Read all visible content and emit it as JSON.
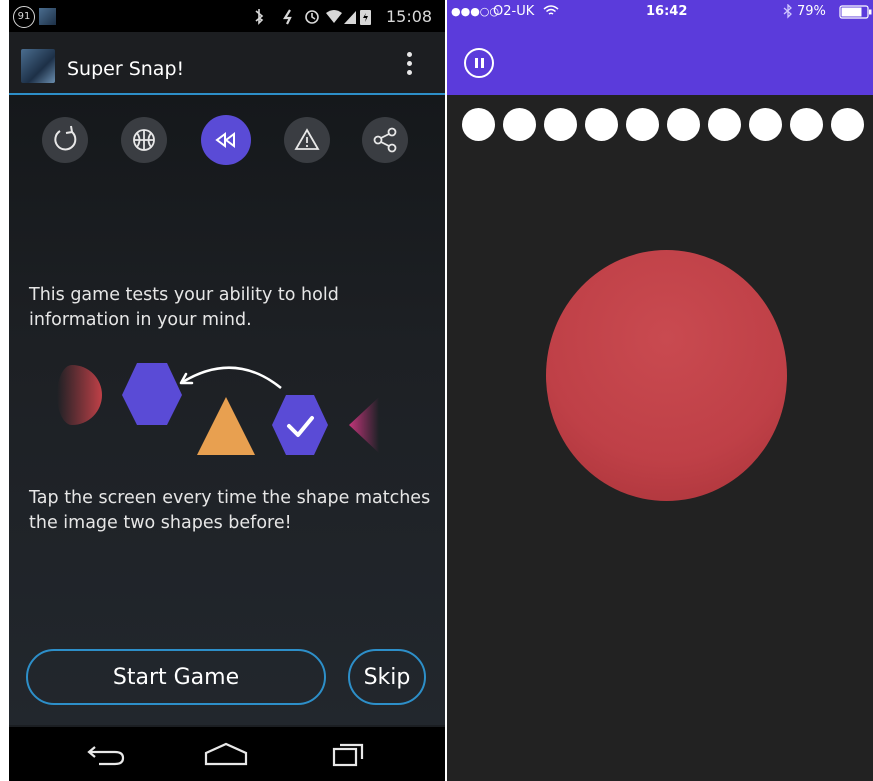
{
  "android": {
    "status_bar": {
      "notification_count": "91",
      "time": "15:08"
    },
    "app_bar": {
      "title": "Super Snap!"
    },
    "toolbar_icons": [
      "replay-icon",
      "basketball-icon",
      "rewind-icon",
      "warning-icon",
      "share-icon"
    ],
    "description_top": "This game tests your ability to hold information in your mind.",
    "shapes": [
      "red-semicircle",
      "blue-hexagon",
      "orange-triangle",
      "blue-hexagon-check",
      "pink-diamond"
    ],
    "description_bottom": "Tap the screen every time the shape matches the image two shapes before!",
    "start_label": "Start Game",
    "skip_label": "Skip",
    "nav_icons": [
      "back-icon",
      "home-icon",
      "recents-icon"
    ]
  },
  "ios": {
    "status_bar": {
      "signal": "●●●○○",
      "carrier": "O2-UK",
      "time": "16:42",
      "battery": "79%"
    },
    "progress_dot_count": 10,
    "stimulus_shape": "red-circle"
  },
  "colors": {
    "accent_blue": "#2d8fc9",
    "purple": "#5b3bdb",
    "shape_blue": "#5a4bd6",
    "shape_orange": "#e8a050",
    "shape_red": "#bf4047"
  }
}
